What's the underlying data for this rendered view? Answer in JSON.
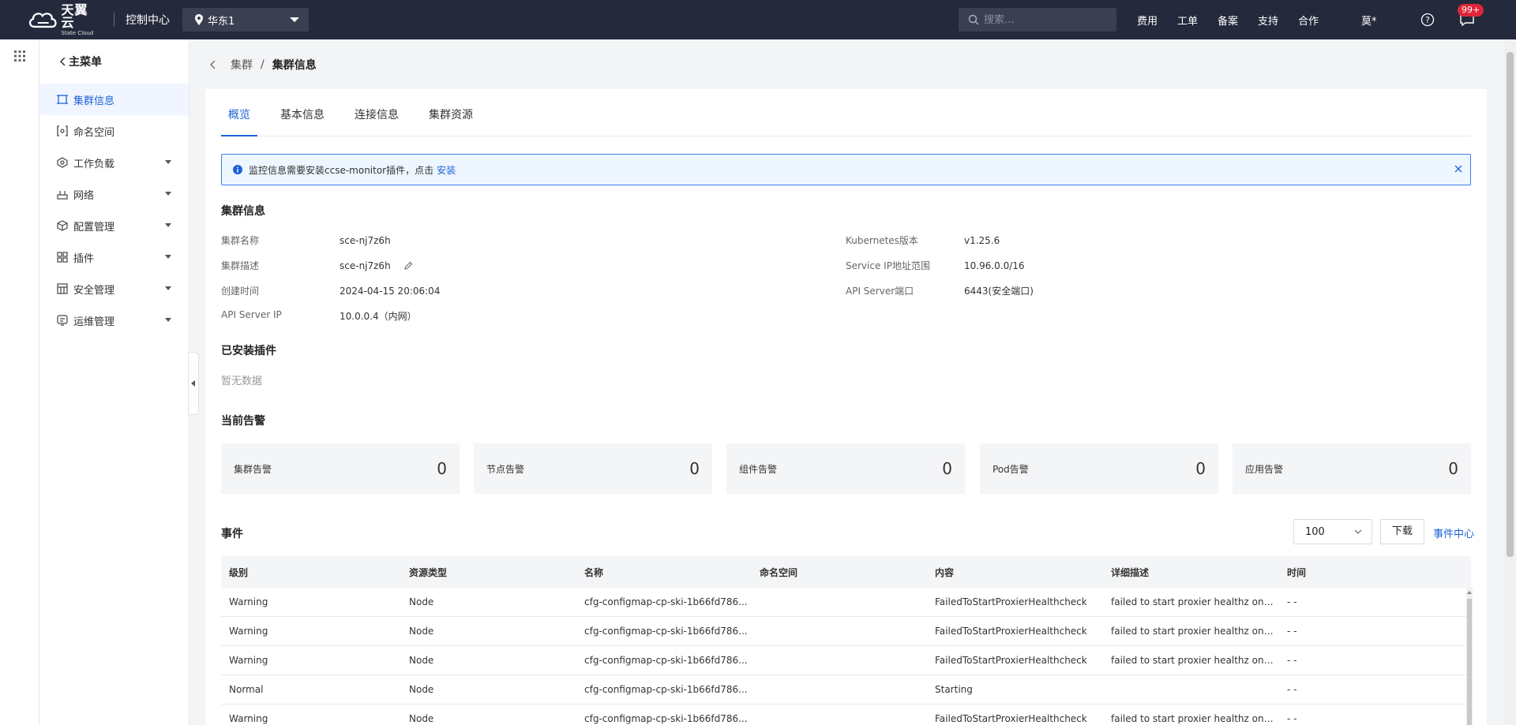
{
  "topbar": {
    "brand_cn": "天翼云",
    "brand_en": "State Cloud",
    "console_title": "控制中心",
    "region": "华东1",
    "search_placeholder": "搜索...",
    "links": [
      "费用",
      "工单",
      "备案",
      "支持",
      "合作"
    ],
    "user": "莫*",
    "message_badge": "99+"
  },
  "sidebar": {
    "back_label": "主菜单",
    "items": [
      {
        "label": "集群信息",
        "icon": "cluster-icon",
        "active": true,
        "expandable": false
      },
      {
        "label": "命名空间",
        "icon": "namespace-icon",
        "active": false,
        "expandable": false
      },
      {
        "label": "工作负载",
        "icon": "workload-icon",
        "active": false,
        "expandable": true
      },
      {
        "label": "网络",
        "icon": "network-icon",
        "active": false,
        "expandable": true
      },
      {
        "label": "配置管理",
        "icon": "config-icon",
        "active": false,
        "expandable": true
      },
      {
        "label": "插件",
        "icon": "plugin-icon",
        "active": false,
        "expandable": true
      },
      {
        "label": "安全管理",
        "icon": "security-icon",
        "active": false,
        "expandable": true
      },
      {
        "label": "运维管理",
        "icon": "ops-icon",
        "active": false,
        "expandable": true
      }
    ]
  },
  "breadcrumb": {
    "parent": "集群",
    "separator": "/",
    "current": "集群信息"
  },
  "tabs": [
    "概览",
    "基本信息",
    "连接信息",
    "集群资源"
  ],
  "alert": {
    "message": "监控信息需要安装ccse-monitor插件，点击",
    "link": "安装"
  },
  "cluster_info": {
    "title": "集群信息",
    "left": [
      {
        "key": "集群名称",
        "value": "sce-nj7z6h"
      },
      {
        "key": "集群描述",
        "value": "sce-nj7z6h"
      },
      {
        "key": "创建时间",
        "value": "2024-04-15 20:06:04"
      },
      {
        "key": "API Server IP",
        "value": "10.0.0.4（内网）"
      }
    ],
    "right": [
      {
        "key": "Kubernetes版本",
        "value": "v1.25.6"
      },
      {
        "key": "Service IP地址范围",
        "value": "10.96.0.0/16"
      },
      {
        "key": "API Server端口",
        "value": "6443(安全端口)"
      }
    ]
  },
  "plugins": {
    "title": "已安装插件",
    "empty": "暂无数据"
  },
  "alarms": {
    "title": "当前告警",
    "items": [
      {
        "name": "集群告警",
        "count": "0"
      },
      {
        "name": "节点告警",
        "count": "0"
      },
      {
        "name": "组件告警",
        "count": "0"
      },
      {
        "name": "Pod告警",
        "count": "0"
      },
      {
        "name": "应用告警",
        "count": "0"
      }
    ]
  },
  "events": {
    "title": "事件",
    "page_size": "100",
    "download": "下载",
    "event_center": "事件中心",
    "columns": [
      "级别",
      "资源类型",
      "名称",
      "命名空间",
      "内容",
      "详细描述",
      "时间"
    ],
    "rows": [
      [
        "Warning",
        "Node",
        "cfg-configmap-cp-ski-1b66fd786...",
        "",
        "FailedToStartProxierHealthcheck",
        "failed to start proxier healthz on ...",
        "- -"
      ],
      [
        "Warning",
        "Node",
        "cfg-configmap-cp-ski-1b66fd786...",
        "",
        "FailedToStartProxierHealthcheck",
        "failed to start proxier healthz on ...",
        "- -"
      ],
      [
        "Warning",
        "Node",
        "cfg-configmap-cp-ski-1b66fd786...",
        "",
        "FailedToStartProxierHealthcheck",
        "failed to start proxier healthz on ...",
        "- -"
      ],
      [
        "Normal",
        "Node",
        "cfg-configmap-cp-ski-1b66fd786...",
        "",
        "Starting",
        "",
        "- -"
      ],
      [
        "Warning",
        "Node",
        "cfg-configmap-cp-ski-1b66fd786...",
        "",
        "FailedToStartProxierHealthcheck",
        "failed to start proxier healthz on ...",
        "- -"
      ]
    ]
  }
}
